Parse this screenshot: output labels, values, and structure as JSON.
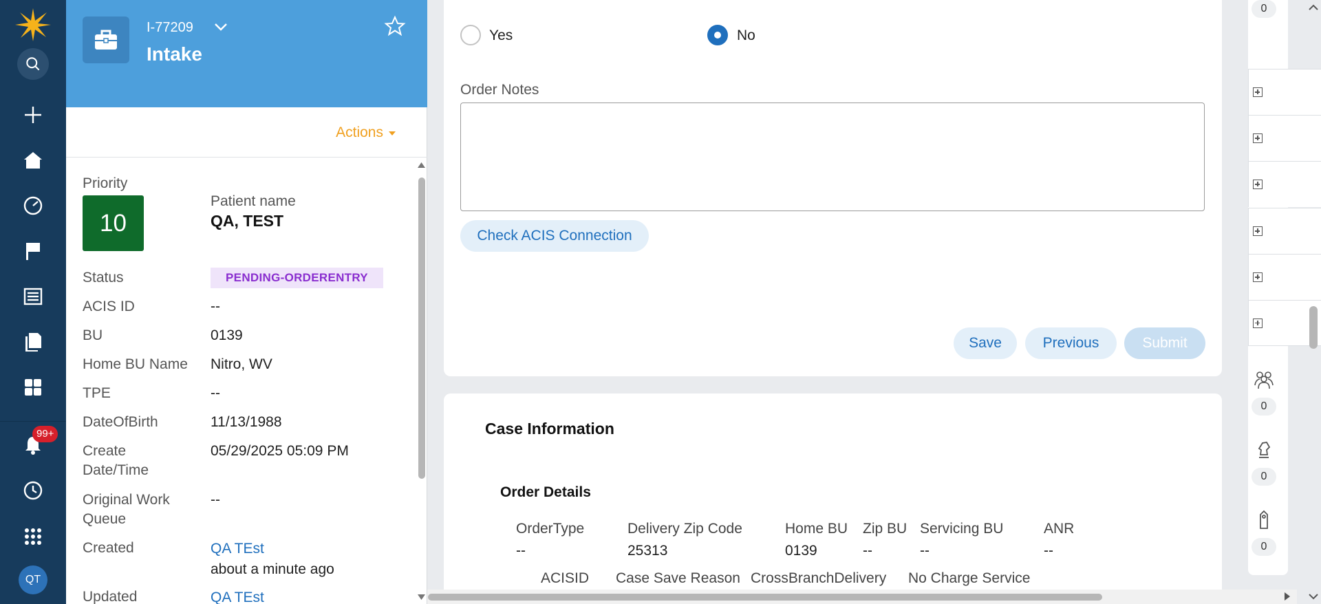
{
  "nav": {
    "notifications_badge": "99+",
    "avatar_initials": "QT"
  },
  "case": {
    "id": "I-77209",
    "type": "Intake",
    "actions_label": "Actions",
    "priority_label": "Priority",
    "priority_value": "10",
    "patient_name_label": "Patient name",
    "patient_name": "QA, TEST",
    "fields": {
      "status_label": "Status",
      "status": "PENDING-ORDERENTRY",
      "acis_id_label": "ACIS ID",
      "acis_id": "--",
      "bu_label": "BU",
      "bu": "0139",
      "home_bu_name_label": "Home BU Name",
      "home_bu_name": "Nitro, WV",
      "tpe_label": "TPE",
      "tpe": "--",
      "dob_label": "DateOfBirth",
      "dob": "11/13/1988",
      "create_label_1": "Create",
      "create_label_2": "Date/Time",
      "create": "05/29/2025 05:09 PM",
      "owq_label_1": "Original Work",
      "owq_label_2": "Queue",
      "owq": "--",
      "created_label": "Created",
      "created_by": "QA TEst",
      "created_when": "about a minute ago",
      "updated_label": "Updated",
      "updated_by": "QA TEst"
    }
  },
  "form": {
    "yes_label": "Yes",
    "no_label": "No",
    "selected": "No",
    "order_notes_label": "Order Notes",
    "order_notes_value": "",
    "check_acis_label": "Check ACIS Connection",
    "save_label": "Save",
    "previous_label": "Previous",
    "submit_label": "Submit"
  },
  "case_info": {
    "title": "Case Information",
    "order_details_title": "Order Details",
    "columns": [
      {
        "header": "OrderType",
        "value": "--"
      },
      {
        "header": "Delivery Zip Code",
        "value": "25313"
      },
      {
        "header": "Home BU",
        "value": "0139"
      },
      {
        "header": "Zip BU",
        "value": "--"
      },
      {
        "header": "Servicing BU",
        "value": "--"
      },
      {
        "header": "ANR",
        "value": "--"
      }
    ],
    "columns_row2": [
      "ACISID",
      "Case Save Reason",
      "CrossBranchDelivery",
      "No Charge Service"
    ]
  },
  "rail": {
    "counts": [
      "0",
      "0",
      "0",
      "0"
    ]
  },
  "colors": {
    "nav_bg": "#173b5c",
    "header_bg": "#4d9fdc",
    "priority_bg": "#0f6b2b",
    "status_badge_bg": "#efe4fa",
    "status_badge_text": "#8a2ecf",
    "link": "#1f6fbd",
    "actions": "#f0a020"
  }
}
